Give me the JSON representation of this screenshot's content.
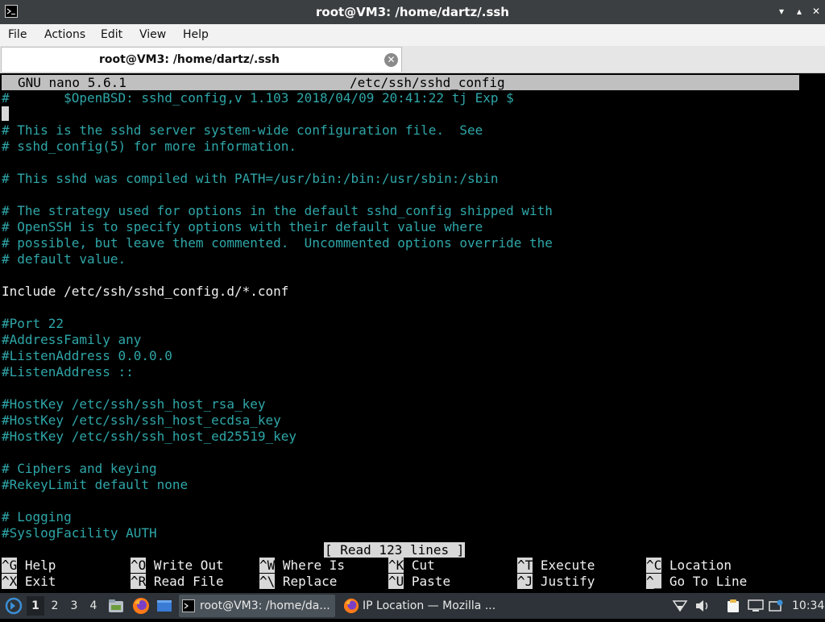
{
  "window": {
    "title": "root@VM3: /home/dartz/.ssh",
    "icon": "terminal-icon",
    "controls": [
      "minimize-icon",
      "maximize-icon",
      "close-icon"
    ]
  },
  "menubar": [
    "File",
    "Actions",
    "Edit",
    "View",
    "Help"
  ],
  "tab": {
    "title": "root@VM3: /home/dartz/.ssh",
    "close_icon": "close-icon"
  },
  "nano": {
    "version": "GNU nano 5.6.1",
    "filename": "/etc/ssh/sshd_config",
    "lines": [
      "#       $OpenBSD: sshd_config,v 1.103 2018/04/09 20:41:22 tj Exp $",
      "",
      "# This is the sshd server system-wide configuration file.  See",
      "# sshd_config(5) for more information.",
      "",
      "# This sshd was compiled with PATH=/usr/bin:/bin:/usr/sbin:/sbin",
      "",
      "# The strategy used for options in the default sshd_config shipped with",
      "# OpenSSH is to specify options with their default value where",
      "# possible, but leave them commented.  Uncommented options override the",
      "# default value.",
      "",
      "Include /etc/ssh/sshd_config.d/*.conf",
      "",
      "#Port 22",
      "#AddressFamily any",
      "#ListenAddress 0.0.0.0",
      "#ListenAddress ::",
      "",
      "#HostKey /etc/ssh/ssh_host_rsa_key",
      "#HostKey /etc/ssh/ssh_host_ecdsa_key",
      "#HostKey /etc/ssh/ssh_host_ed25519_key",
      "",
      "# Ciphers and keying",
      "#RekeyLimit default none",
      "",
      "# Logging",
      "#SyslogFacility AUTH"
    ],
    "status": "[ Read 123 lines ]",
    "shortcuts": [
      [
        {
          "key": "^G",
          "label": "Help"
        },
        {
          "key": "^O",
          "label": "Write Out"
        },
        {
          "key": "^W",
          "label": "Where Is"
        },
        {
          "key": "^K",
          "label": "Cut"
        },
        {
          "key": "^T",
          "label": "Execute"
        },
        {
          "key": "^C",
          "label": "Location"
        }
      ],
      [
        {
          "key": "^X",
          "label": "Exit"
        },
        {
          "key": "^R",
          "label": "Read File"
        },
        {
          "key": "^\\",
          "label": "Replace"
        },
        {
          "key": "^U",
          "label": "Paste"
        },
        {
          "key": "^J",
          "label": "Justify"
        },
        {
          "key": "^_",
          "label": "Go To Line"
        }
      ]
    ]
  },
  "taskbar": {
    "menu_icon": "start-menu-icon",
    "workspaces": [
      "1",
      "2",
      "3",
      "4"
    ],
    "launchers": [
      "file-manager-icon",
      "firefox-icon",
      "show-desktop-icon"
    ],
    "windows": [
      {
        "label": "root@VM3: /home/da...",
        "icon": "terminal-icon",
        "active": true
      },
      {
        "label": "IP Location — Mozilla ...",
        "icon": "firefox-icon",
        "active": false
      }
    ],
    "tray": [
      "network-icon",
      "volume-icon",
      "clipboard-icon",
      "display-icon",
      "update-icon"
    ],
    "clock": "10:34"
  },
  "colors": {
    "comment": "#2fa6a8",
    "text": "#f0f0f0",
    "header_bg": "#c0c0c0",
    "taskbar_bg": "#2d3338",
    "titlebar_bg": "#3c3f41"
  }
}
